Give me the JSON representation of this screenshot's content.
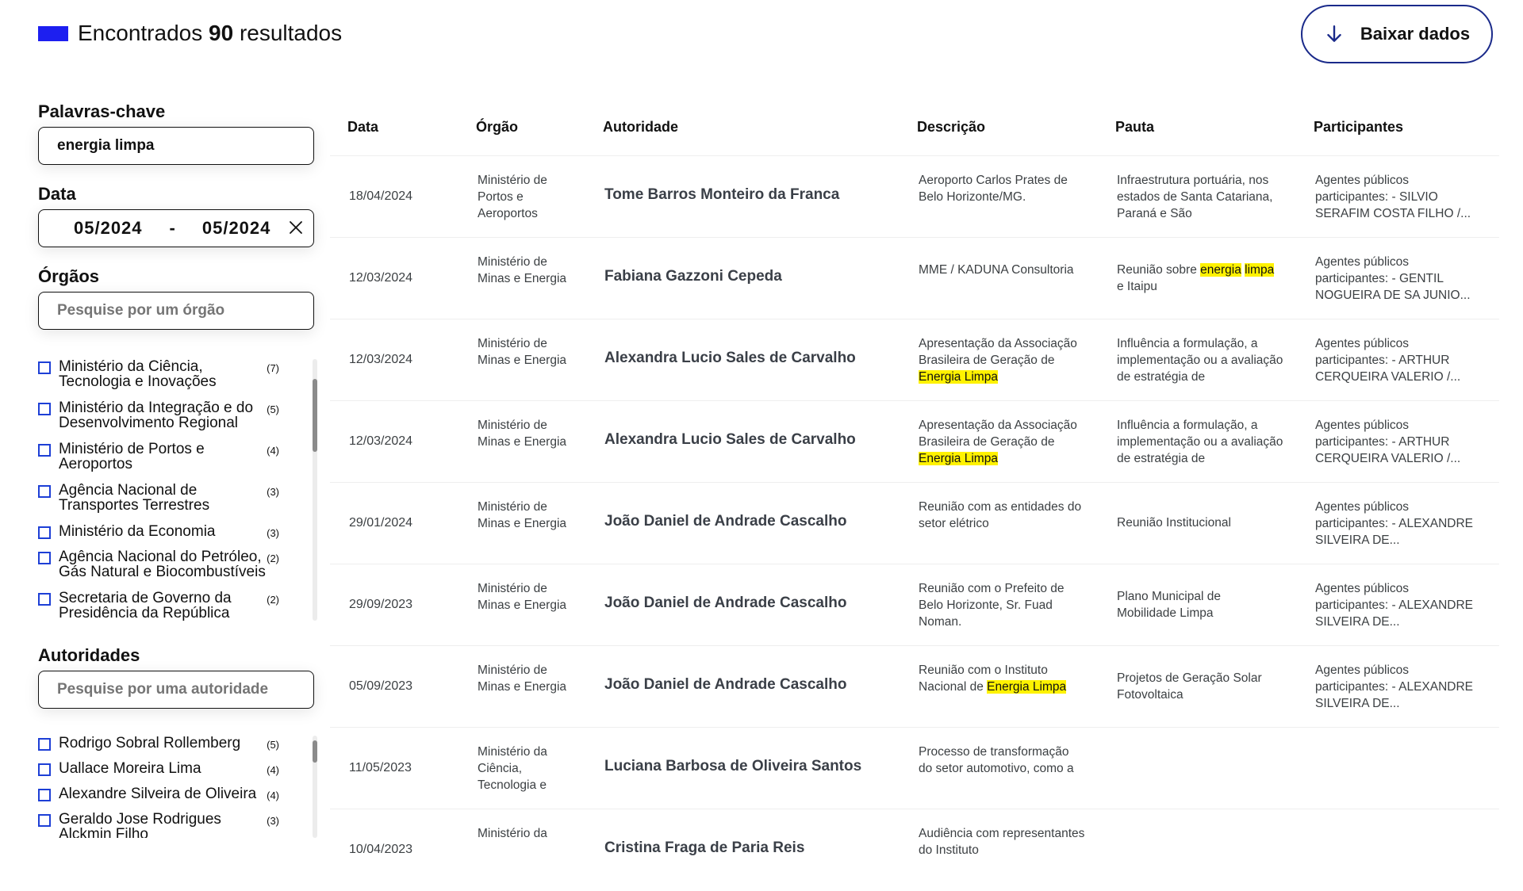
{
  "colors": {
    "accent": "#1d1ff0",
    "checkbox": "#1d3fd6",
    "highlight": "#fff200",
    "button_border": "#1a2a8a"
  },
  "header": {
    "results_prefix": "Encontrados",
    "results_count": "90",
    "results_suffix": "resultados",
    "download_label": "Baixar dados",
    "download_icon": "arrow-down-icon"
  },
  "filters": {
    "keywords": {
      "title": "Palavras-chave",
      "value": "energia limpa"
    },
    "date": {
      "title": "Data",
      "from": "05/2024",
      "separator": "-",
      "to": "05/2024",
      "clear_icon": "close-icon"
    },
    "orgaos": {
      "title": "Órgãos",
      "placeholder": "Pesquise por um órgão",
      "items": [
        {
          "label": "Ministério da Ciência, Tecnologia e Inovações",
          "count": "(7)"
        },
        {
          "label": "Ministério da Integração e do Desenvolvimento Regional",
          "count": "(5)"
        },
        {
          "label": "Ministério de Portos e Aeroportos",
          "count": "(4)"
        },
        {
          "label": "Agência Nacional de Transportes Terrestres",
          "count": "(3)"
        },
        {
          "label": "Ministério da Economia",
          "count": "(3)"
        },
        {
          "label": "Agência Nacional do Petróleo, Gás Natural e Biocombustíveis",
          "count": "(2)"
        },
        {
          "label": "Secretaria de Governo da Presidência da República",
          "count": "(2)"
        }
      ]
    },
    "autoridades": {
      "title": "Autoridades",
      "placeholder": "Pesquise por uma autoridade",
      "items": [
        {
          "label": "Rodrigo Sobral Rollemberg",
          "count": "(5)"
        },
        {
          "label": "Uallace Moreira Lima",
          "count": "(4)"
        },
        {
          "label": "Alexandre Silveira de Oliveira",
          "count": "(4)"
        },
        {
          "label": "Geraldo Jose Rodrigues Alckmin Filho",
          "count": "(3)"
        }
      ]
    }
  },
  "table": {
    "columns": [
      "Data",
      "Órgão",
      "Autoridade",
      "Descrição",
      "Pauta",
      "Participantes"
    ],
    "rows": [
      {
        "data": "18/04/2024",
        "orgao": "Ministério de Portos e Aeroportos",
        "autoridade": "Tome Barros Monteiro da Franca",
        "descricao": [
          {
            "t": "Aeroporto Carlos Prates de Belo Horizonte/MG."
          }
        ],
        "pauta": [
          {
            "t": "Infraestrutura portuária, nos estados de Santa Catariana, Paraná e São"
          }
        ],
        "participantes": "Agentes públicos participantes: - SILVIO SERAFIM COSTA FILHO /..."
      },
      {
        "data": "12/03/2024",
        "orgao": "Ministério de Minas e Energia",
        "autoridade": "Fabiana Gazzoni Cepeda",
        "descricao": [
          {
            "t": "MME / KADUNA Consultoria"
          }
        ],
        "pauta": [
          {
            "t": "Reunião sobre "
          },
          {
            "t": "energia",
            "hl": true
          },
          {
            "t": " "
          },
          {
            "t": "limpa",
            "hl": true
          },
          {
            "t": " e Itaipu"
          }
        ],
        "participantes": "Agentes públicos participantes: - GENTIL NOGUEIRA DE SA JUNIO..."
      },
      {
        "data": "12/03/2024",
        "orgao": "Ministério de Minas e Energia",
        "autoridade": "Alexandra Lucio Sales de Carvalho",
        "descricao": [
          {
            "t": "Apresentação da Associação Brasileira de Geração de "
          },
          {
            "t": "Energia Limpa",
            "hl": true
          }
        ],
        "pauta": [
          {
            "t": "Influência a formulação, a implementação ou a avaliação de estratégia de"
          }
        ],
        "participantes": "Agentes públicos participantes: - ARTHUR CERQUEIRA VALERIO /..."
      },
      {
        "data": "12/03/2024",
        "orgao": "Ministério de Minas e Energia",
        "autoridade": "Alexandra Lucio Sales de Carvalho",
        "descricao": [
          {
            "t": "Apresentação da Associação Brasileira de Geração de "
          },
          {
            "t": "Energia Limpa",
            "hl": true
          }
        ],
        "pauta": [
          {
            "t": "Influência a formulação, a implementação ou a avaliação de estratégia de"
          }
        ],
        "participantes": "Agentes públicos participantes: - ARTHUR CERQUEIRA VALERIO /..."
      },
      {
        "data": "29/01/2024",
        "orgao": "Ministério de Minas e Energia",
        "autoridade": "João Daniel de Andrade Cascalho",
        "descricao": [
          {
            "t": "Reunião com as entidades do setor elétrico"
          }
        ],
        "pauta": [
          {
            "t": "Reunião Institucional"
          }
        ],
        "participantes": "Agentes públicos participantes: - ALEXANDRE SILVEIRA DE..."
      },
      {
        "data": "29/09/2023",
        "orgao": "Ministério de Minas e Energia",
        "autoridade": "João Daniel de Andrade Cascalho",
        "descricao": [
          {
            "t": "Reunião com o Prefeito de Belo Horizonte, Sr. Fuad Noman."
          }
        ],
        "pauta": [
          {
            "t": "Plano Municipal de Mobilidade Limpa"
          }
        ],
        "participantes": "Agentes públicos participantes: - ALEXANDRE SILVEIRA DE..."
      },
      {
        "data": "05/09/2023",
        "orgao": "Ministério de Minas e Energia",
        "autoridade": "João Daniel de Andrade Cascalho",
        "descricao": [
          {
            "t": "Reunião com o Instituto Nacional de "
          },
          {
            "t": "Energia Limpa",
            "hl": true
          }
        ],
        "pauta": [
          {
            "t": "Projetos de Geração Solar Fotovoltaica"
          }
        ],
        "participantes": "Agentes públicos participantes: - ALEXANDRE SILVEIRA DE..."
      },
      {
        "data": "11/05/2023",
        "orgao": "Ministério da Ciência, Tecnologia e",
        "autoridade": "Luciana Barbosa de Oliveira Santos",
        "descricao": [
          {
            "t": "Processo de transformação do setor automotivo, como a"
          }
        ],
        "pauta": [
          {
            "t": ""
          }
        ],
        "participantes": ""
      },
      {
        "data": "10/04/2023",
        "orgao": "Ministério da",
        "autoridade": "Cristina Fraga de Paria Reis",
        "descricao": [
          {
            "t": "Audiência com representantes do Instituto"
          }
        ],
        "pauta": [
          {
            "t": ""
          }
        ],
        "participantes": ""
      }
    ]
  }
}
